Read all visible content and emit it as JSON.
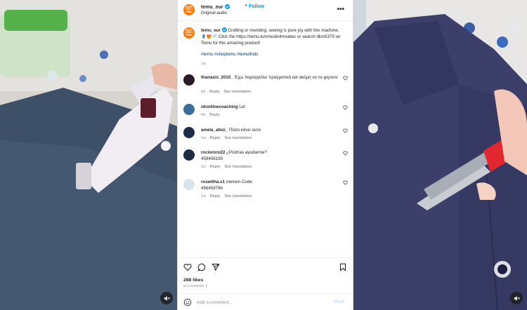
{
  "post": {
    "username": "temu_eur",
    "follow_label": "Follow",
    "separator": "•",
    "audio_label": "Original audio",
    "avatar_text": "SHOP LIKE A TEMU",
    "more_icon": "more-horizontal-icon",
    "caption_text": "Crafting or mending, sewing is pure joy with this machine. 🧵😍🪡 Click the https://temu.to/m/ec8x4mxalwc or search dkm5375 on Temu for this amazing product!",
    "hashtags": "#temu #shoptemu #temufinds",
    "caption_time": "1w"
  },
  "comments": [
    {
      "username": "thanasis_2010_",
      "text": "Έχω παραγγείλει πραγματικά και ακόμη να τα φερουν",
      "time": "6d",
      "reply": "Reply",
      "translate": "See translation",
      "avatar_color": "#2a1a2a"
    },
    {
      "username": "nkonlinecoaching",
      "text": "Lol",
      "time": "4d",
      "reply": "Reply",
      "translate": "",
      "avatar_color": "#3c6e9c"
    },
    {
      "username": "amela_afezi_",
      "text": "Πόσο κάνει αυτο",
      "time": "1w",
      "reply": "Reply",
      "translate": "See translation",
      "avatar_color": "#1f2a4a"
    },
    {
      "username": "rociororo22",
      "text": "¿Podrías ayudarme? 459406199",
      "time": "1w",
      "reply": "Reply",
      "translate": "See translation",
      "avatar_color": "#1e2b40"
    },
    {
      "username": "roswitha.s1",
      "text": "meinen Code: 456458786",
      "time": "1w",
      "reply": "Reply",
      "translate": "See translation",
      "avatar_color": "#d8e4ea"
    }
  ],
  "actions": {
    "likes": "288 likes",
    "date": "NOVEMBER 9",
    "comment_placeholder": "Add a comment...",
    "post_label": "Post"
  },
  "colors": {
    "brand": "#fb7701",
    "link": "#0095f6",
    "hashtag": "#00376b",
    "muted": "#8e8e8e"
  }
}
